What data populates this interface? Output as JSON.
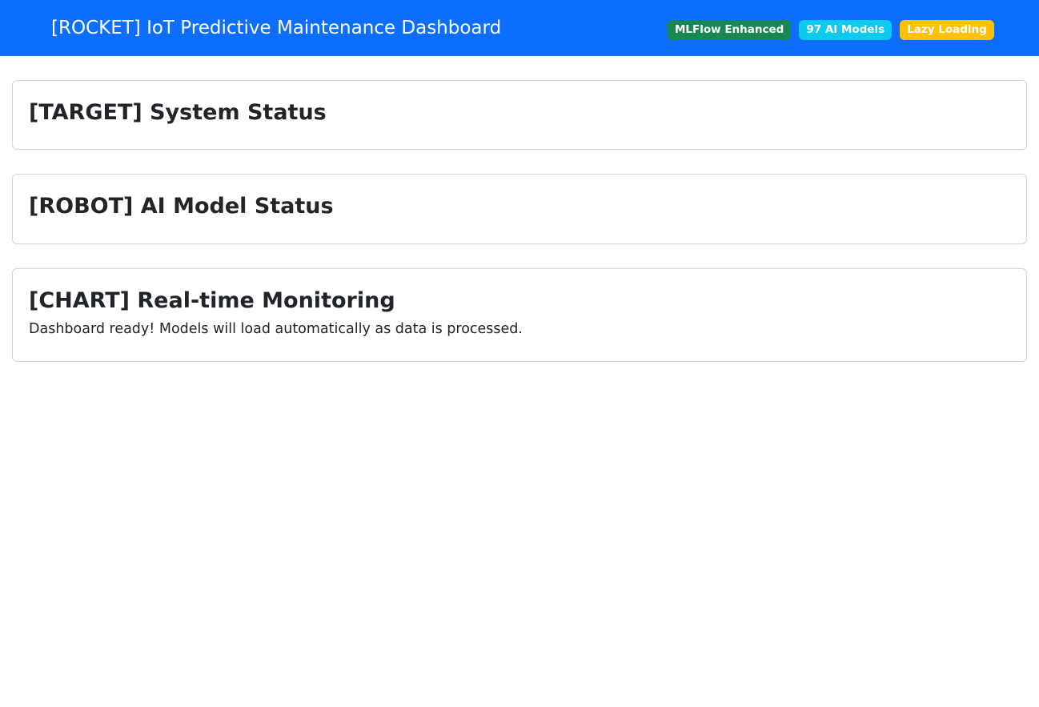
{
  "header": {
    "title": "[ROCKET] IoT Predictive Maintenance Dashboard",
    "background_color": "#0d6efd",
    "badges": [
      {
        "label": "MLFlow Enhanced",
        "color": "#198754"
      },
      {
        "label": "97 AI Models",
        "color": "#0dcaf0"
      },
      {
        "label": "Lazy Loading",
        "color": "#ffc107"
      }
    ]
  },
  "cards": {
    "system_status": {
      "title": "[TARGET] System Status"
    },
    "model_status": {
      "title": "[ROBOT] AI Model Status"
    },
    "monitoring": {
      "title": "[CHART] Real-time Monitoring",
      "message": "Dashboard ready! Models will load automatically as data is processed."
    }
  }
}
